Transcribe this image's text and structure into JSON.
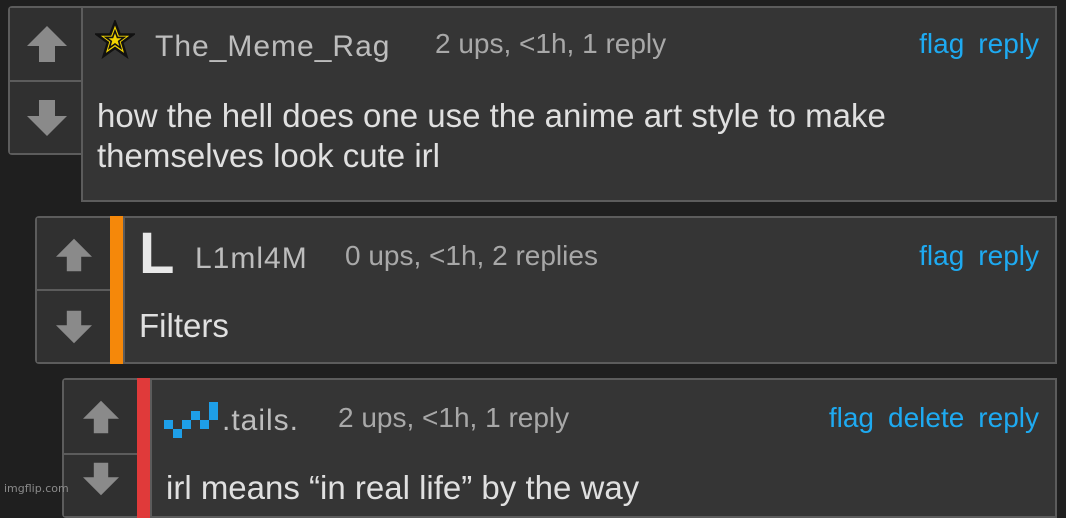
{
  "comments": [
    {
      "username": "The_Meme_Rag",
      "meta": "2 ups, <1h, 1 reply",
      "actions": [
        "flag",
        "reply"
      ],
      "text": "how the hell does one use the anime art style to make themselves look cute irl",
      "avatar_icon": "gold-star-icon"
    },
    {
      "username": "L1ml4M",
      "meta": "0 ups, <1h, 2 replies",
      "actions": [
        "flag",
        "reply"
      ],
      "text": "Filters",
      "avatar_letter": "L",
      "stripe_color": "#f5880a"
    },
    {
      "username": ".tails.",
      "meta": "2 ups, <1h, 1 reply",
      "actions": [
        "flag",
        "delete",
        "reply"
      ],
      "text": "irl means “in real life” by the way",
      "avatar_icon": "blue-pixel-squiggle-icon",
      "stripe_color": "#e03a3a"
    }
  ],
  "colors": {
    "background": "#1f1f1f",
    "comment_bg": "#353535",
    "border": "#5c5c5c",
    "action_link": "#1eaaf1"
  },
  "watermark": "imgflip.com"
}
